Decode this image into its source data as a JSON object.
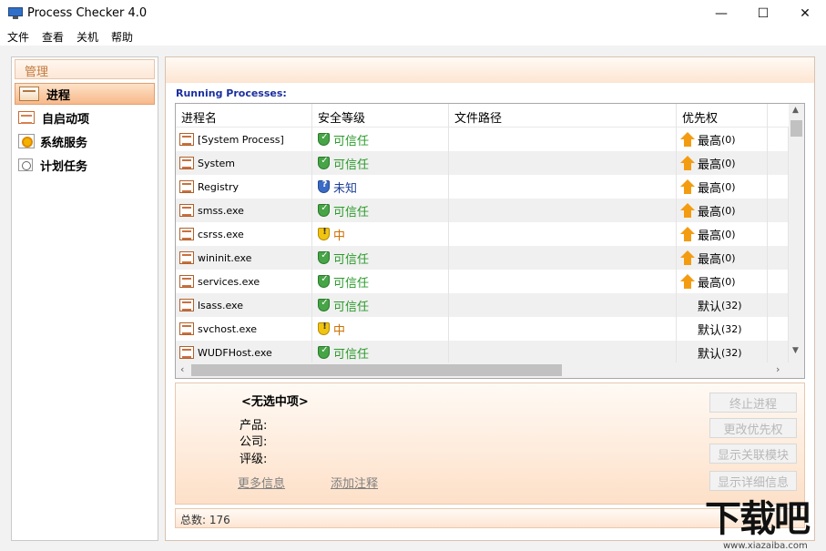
{
  "window": {
    "title": "Process Checker 4.0",
    "minimize": "—",
    "maximize": "☐",
    "close": "✕"
  },
  "menu": [
    "文件",
    "查看",
    "关机",
    "帮助"
  ],
  "sidebar": {
    "header": "管理",
    "items": [
      {
        "label": "进程",
        "icon": "process-window-icon",
        "active": true
      },
      {
        "label": "自启动项",
        "icon": "startup-list-icon",
        "active": false
      },
      {
        "label": "系统服务",
        "icon": "service-gear-icon",
        "active": false
      },
      {
        "label": "计划任务",
        "icon": "scheduled-clock-icon",
        "active": false
      }
    ]
  },
  "main": {
    "section_label": "Running Processes:",
    "columns": [
      "进程名",
      "安全等级",
      "文件路径",
      "优先权"
    ],
    "rows": [
      {
        "name": "[System Process]",
        "level": "可信任",
        "level_type": "green",
        "path": "",
        "priority": "最高",
        "priority_num": "(0)",
        "arrow": true
      },
      {
        "name": "System",
        "level": "可信任",
        "level_type": "green",
        "path": "",
        "priority": "最高",
        "priority_num": "(0)",
        "arrow": true
      },
      {
        "name": "Registry",
        "level": "未知",
        "level_type": "blue",
        "path": "",
        "priority": "最高",
        "priority_num": "(0)",
        "arrow": true
      },
      {
        "name": "smss.exe",
        "level": "可信任",
        "level_type": "green",
        "path": "",
        "priority": "最高",
        "priority_num": "(0)",
        "arrow": true
      },
      {
        "name": "csrss.exe",
        "level": "中",
        "level_type": "orange",
        "path": "",
        "priority": "最高",
        "priority_num": "(0)",
        "arrow": true
      },
      {
        "name": "wininit.exe",
        "level": "可信任",
        "level_type": "green",
        "path": "",
        "priority": "最高",
        "priority_num": "(0)",
        "arrow": true
      },
      {
        "name": "services.exe",
        "level": "可信任",
        "level_type": "green",
        "path": "",
        "priority": "最高",
        "priority_num": "(0)",
        "arrow": true
      },
      {
        "name": "lsass.exe",
        "level": "可信任",
        "level_type": "green",
        "path": "",
        "priority": "默认",
        "priority_num": "(32)",
        "arrow": false
      },
      {
        "name": "svchost.exe",
        "level": "中",
        "level_type": "orange",
        "path": "",
        "priority": "默认",
        "priority_num": "(32)",
        "arrow": false
      },
      {
        "name": "WUDFHost.exe",
        "level": "可信任",
        "level_type": "green",
        "path": "",
        "priority": "默认",
        "priority_num": "(32)",
        "arrow": false
      }
    ]
  },
  "details": {
    "title": "<无选中项>",
    "product_label": "产品:",
    "company_label": "公司:",
    "rating_label": "评级:",
    "more_info": "更多信息",
    "add_note": "添加注释",
    "buttons": [
      "终止进程",
      "更改优先权",
      "显示关联模块",
      "显示详细信息"
    ]
  },
  "status": {
    "total": "总数: 176"
  },
  "watermark": {
    "big": "下载吧",
    "small": "www.xiazaiba.com"
  },
  "colors": {
    "accent": "#f7b98a",
    "trusted": "#2a9a2a",
    "unknown": "#1c3f9a",
    "medium": "#d07000",
    "section_label": "#1a2fa0"
  }
}
